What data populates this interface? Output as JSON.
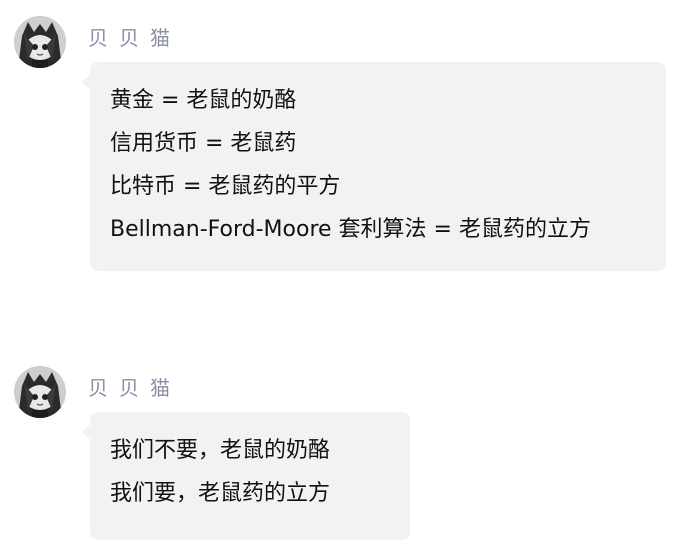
{
  "messages": [
    {
      "sender": "贝贝猫",
      "lines": [
        "黄金 = 老鼠的奶酪",
        "信用货币 = 老鼠药",
        "比特币 = 老鼠药的平方",
        "Bellman-Ford-Moore 套利算法 = 老鼠药的立方"
      ]
    },
    {
      "sender": "贝贝猫",
      "lines": [
        "我们不要，老鼠的奶酪",
        "我们要，老鼠药的立方"
      ]
    }
  ],
  "colors": {
    "bubble": "#f2f2f2",
    "sender": "#8a90a8",
    "text": "#111111"
  }
}
